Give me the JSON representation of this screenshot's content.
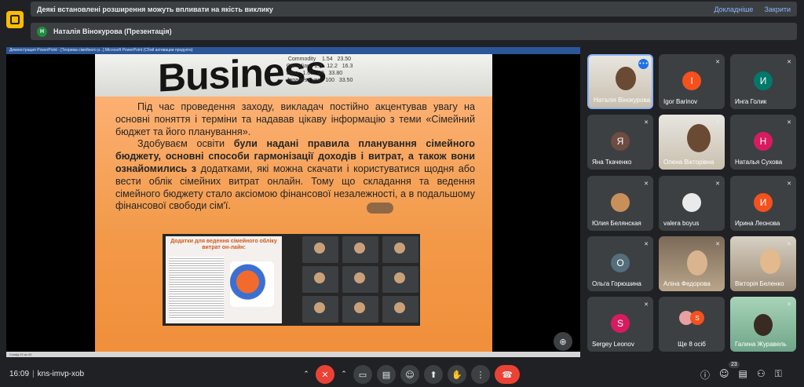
{
  "warning": {
    "text": "Деякі встановлені розширення можуть впливати на якість виклику",
    "more": "Докладніше",
    "close": "Закрити"
  },
  "presenter": {
    "initial": "Н",
    "text": "Наталія Вінокурова (Презентація)"
  },
  "powerpoint": {
    "title": "Демонстрация PowerPoint - [Теорема сімейного р...]   Microsoft PowerPoint (Сбой активации продукта)",
    "status": "Слайд 23 из 33"
  },
  "slide": {
    "banner": "Business",
    "numbers": "   Commodity    1.54   23.50\n  Canadian   2.5   12.2   16.3\n  Euro   1.00   20   33.80\n  Japanese yen   100   33.50",
    "para1": "Під час проведення заходу, викладач постійно акцентував увагу на основні поняття і терміни та надавав цікаву інформацію з теми «Сімейний бюджет та його планування».",
    "para2_intro": "Здобуваєм освіти ",
    "para2_bold": "були надані правила планування сімейного бюджету, основні способи гармонізації доходів і витрат, а також вони ознайомились з",
    "para2_rest": " додатками, які можна скачати і користуватися щодня або вести облік сімейних витрат онлайн. Тому що складання та ведення сімейного бюджету стало аксіомою фінансової незалежності, а в подальшому фінансової свободи сім'ї.",
    "inset_title": "Додатки для ведення сімейного обліку витрат он-лайн:"
  },
  "participants": [
    {
      "name": "Наталія Вінокурова",
      "initial": "",
      "color": "",
      "photo": true
    },
    {
      "name": "Igor Barinov",
      "initial": "I",
      "color": "#f4511e"
    },
    {
      "name": "Инга Голик",
      "initial": "И",
      "color": "#00796b"
    },
    {
      "name": "Яна Ткаченко",
      "initial": "Я",
      "color": "#6d4c41"
    },
    {
      "name": "Олена Вікторівна",
      "initial": "",
      "color": "",
      "photo": true
    },
    {
      "name": "Наталья Сухова",
      "initial": "Н",
      "color": "#d81b60"
    },
    {
      "name": "Юлия Белянская",
      "initial": "",
      "color": "",
      "photo": true
    },
    {
      "name": "valera boyus",
      "initial": "",
      "color": "",
      "photo": true
    },
    {
      "name": "Ирина Леонова",
      "initial": "И",
      "color": "#f4511e"
    },
    {
      "name": "Ольга Горюшина",
      "initial": "О",
      "color": "#546e7a"
    },
    {
      "name": "Аліна Федорова",
      "initial": "",
      "color": "",
      "photo": true
    },
    {
      "name": "Вікторія Беленко",
      "initial": "",
      "color": "",
      "photo": true
    },
    {
      "name": "Sergey Leonov",
      "initial": "S",
      "color": "#d81b60"
    },
    {
      "name": "Ще 8 осіб",
      "initial": "S",
      "color": "#f4511e"
    },
    {
      "name": "Галина Журавель",
      "initial": "",
      "color": "",
      "photo": true
    }
  ],
  "bottom": {
    "time": "16:09",
    "meeting": "kns-imvp-xob",
    "people_count": "23"
  },
  "colors": {
    "end_call": "#ea4335",
    "warning_link": "#8ab4f8",
    "logo": "#fbbc04"
  }
}
